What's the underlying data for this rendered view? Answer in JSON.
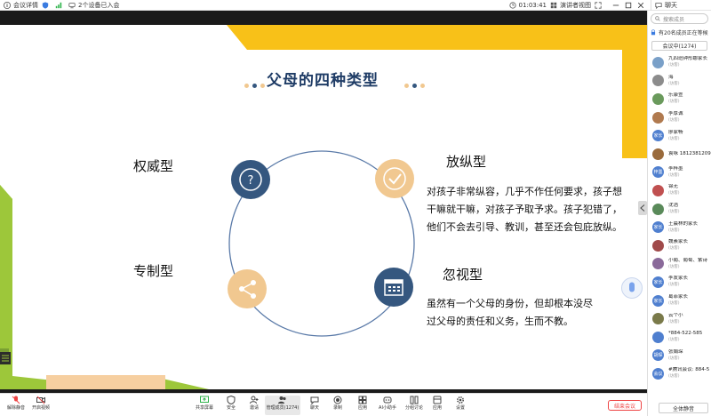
{
  "topbar": {
    "meeting_details": "会议详情",
    "devices_joined": "2个设备已入会",
    "timer": "01:03:41",
    "view_mode": "演讲者视图",
    "chat": "聊天"
  },
  "slide": {
    "title": "父母的四种类型",
    "types": [
      {
        "label": "权威型",
        "icon": "question-icon"
      },
      {
        "label": "放纵型",
        "icon": "check-icon"
      },
      {
        "label": "专制型",
        "icon": "share-icon"
      },
      {
        "label": "忽视型",
        "icon": "calendar-icon"
      }
    ],
    "indulgent_desc": [
      "对孩子非常纵容，几乎不作任何要求，孩子想",
      "干嘛就干嘛，对孩子予取予求。孩子犯错了，",
      "他们不会去引导、教训，甚至还会包庇放纵。"
    ],
    "neglect_desc": [
      "虽然有一个父母的身份，但却根本没尽",
      "过父母的责任和义务，生而不教。"
    ],
    "colors": {
      "navy": "#35577f",
      "peach": "#f1c890",
      "yellow": "#f8c118",
      "green": "#9dc73a",
      "sand": "#f6cfa0",
      "circle": "#5a7aa8"
    }
  },
  "sidebar": {
    "search_placeholder": "搜索成员",
    "notice": "有20名成员正在等候",
    "in_meeting": "会议中(1274)",
    "mute_all": "全体静音",
    "members": [
      {
        "name": "九四班钟彤娜家长",
        "role": "(访客)",
        "avatar": "",
        "color": "#7aa0c8"
      },
      {
        "name": "海",
        "role": "(访客)",
        "avatar": "",
        "color": "#8c8c8c"
      },
      {
        "name": "乐康萱",
        "role": "(访客)",
        "avatar": "",
        "color": "#6a9a5c"
      },
      {
        "name": "李厚诚",
        "role": "(访客)",
        "avatar": "",
        "color": "#b07a4f"
      },
      {
        "name": "廖家畅",
        "role": "(访客)",
        "avatar": "家长",
        "color": "#4f7fcf"
      },
      {
        "name": "袁咏 18123812093",
        "role": "",
        "avatar": "",
        "color": "#9a6b3c"
      },
      {
        "name": "李梓墨",
        "role": "(访客)",
        "avatar": "梓墨",
        "color": "#4f7fcf"
      },
      {
        "name": "锦无",
        "role": "(访客)",
        "avatar": "",
        "color": "#c05050"
      },
      {
        "name": "沈浩",
        "role": "(访客)",
        "avatar": "",
        "color": "#5a8a5a"
      },
      {
        "name": "王晨林的家长",
        "role": "(访客)",
        "avatar": "家长",
        "color": "#4f7fcf"
      },
      {
        "name": "魏素家长",
        "role": "(访客)",
        "avatar": "",
        "color": "#a04a4a"
      },
      {
        "name": "小葡、葡萄、紫诗",
        "role": "(访客)",
        "avatar": "",
        "color": "#8a6a9a"
      },
      {
        "name": "李友家长",
        "role": "(访客)",
        "avatar": "家长",
        "color": "#4f7fcf"
      },
      {
        "name": "葛菲家长",
        "role": "(访客)",
        "avatar": "家长",
        "color": "#4f7fcf"
      },
      {
        "name": "云个小",
        "role": "(访客)",
        "avatar": "",
        "color": "#7a7a4a"
      },
      {
        "name": "*884-522-585",
        "role": "(访客)",
        "avatar": "",
        "color": "#4f7fcf"
      },
      {
        "name": "张娟琛",
        "role": "(访客)",
        "avatar": "胡琛",
        "color": "#4f7fcf"
      },
      {
        "name": "#腾讯会议: 884-5",
        "role": "(访客)",
        "avatar": "会议",
        "color": "#4f7fcf"
      }
    ]
  },
  "toolbar": {
    "left": [
      "解除静音",
      "开启视频"
    ],
    "tools": [
      "共享屏幕",
      "安全",
      "邀请",
      "管理成员(1274)",
      "聊天",
      "录制",
      "应用",
      "AI小助手",
      "分组讨论",
      "应用",
      "设置"
    ],
    "end_label": "结束会议"
  }
}
